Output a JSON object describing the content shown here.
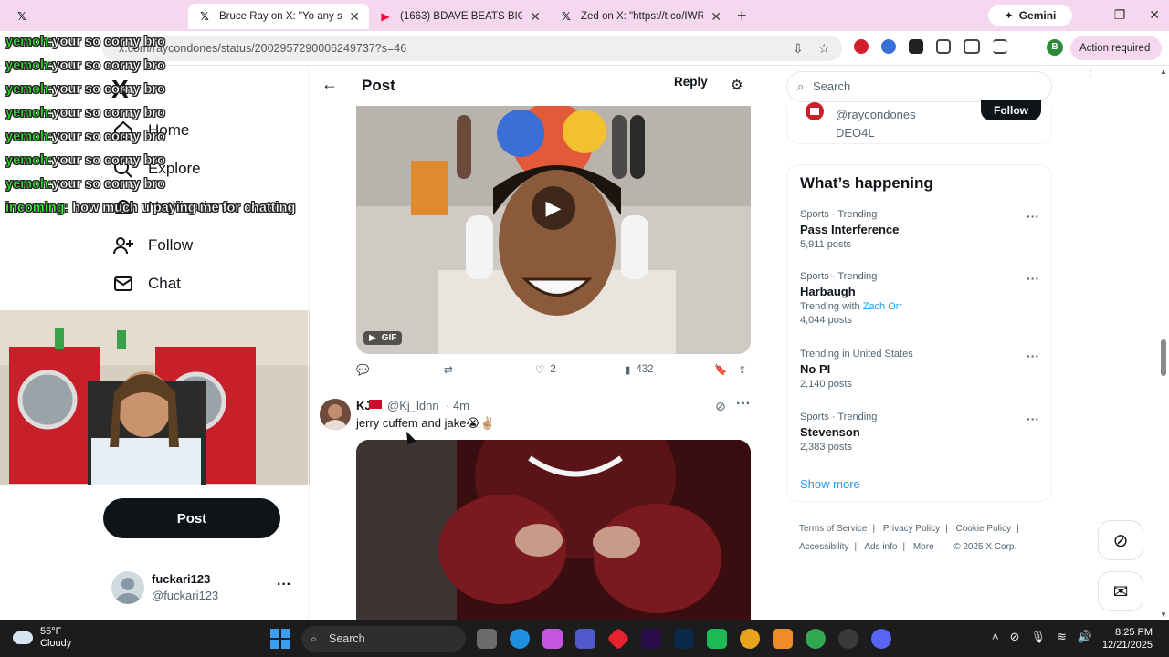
{
  "browser": {
    "tabs": [
      {
        "title": "",
        "active": false
      },
      {
        "title": "Bruce Ray on X: \"Yo any stream",
        "active": true
      },
      {
        "title": "(1663) BDAVE BEATS BIGLOAA",
        "active": false
      },
      {
        "title": "Zed on X: \"https://t.co/IWRJt6",
        "active": false
      }
    ],
    "gemini_label": "Gemini",
    "url": "x.com/raycondones/status/2002957290006249737?s=46",
    "action_required": "Action required",
    "profile_initial": "B"
  },
  "chat_overlay": {
    "lines": [
      {
        "user": "yemoh:",
        "message": "your so corny bro"
      },
      {
        "user": "yemoh:",
        "message": "your so corny bro"
      },
      {
        "user": "yemoh:",
        "message": "your so corny bro"
      },
      {
        "user": "yemoh:",
        "message": "your so corny bro"
      },
      {
        "user": "yemoh:",
        "message": "your so corny bro"
      },
      {
        "user": "yemoh:",
        "message": "your so corny bro"
      },
      {
        "user": "yemoh:",
        "message": "your so corny bro"
      },
      {
        "user": "incoming:",
        "message": "how much u paying me for chatting"
      }
    ]
  },
  "left_nav": {
    "logo": "X",
    "items": [
      {
        "label": "Home",
        "icon": "home-icon"
      },
      {
        "label": "Explore",
        "icon": "search-icon"
      },
      {
        "label": "Notifications",
        "icon": "bell-icon"
      },
      {
        "label": "Follow",
        "icon": "person-add-icon"
      },
      {
        "label": "Chat",
        "icon": "mail-icon"
      }
    ],
    "post_button": "Post",
    "account": {
      "name": "fuckari123",
      "handle": "@fuckari123"
    }
  },
  "main": {
    "header_title": "Post",
    "reply_label": "Reply",
    "gif_badge": "GIF",
    "tweet1_actions": {
      "likes": "2",
      "views": "432"
    },
    "tweet2": {
      "name": "KJ",
      "handle": "@Kj_ldnn",
      "time": "· 4m",
      "text": "jerry cuffem and jake😭✌🏼"
    }
  },
  "sidebar": {
    "search_placeholder": "Search",
    "who_to_follow": {
      "handle": "@raycondones",
      "name": "DEO4L",
      "button": "Follow"
    },
    "happening_title": "What’s happening",
    "trends": [
      {
        "context": "Sports · Trending",
        "topic": "Pass Interference",
        "with_label": "",
        "with_link": "",
        "count": "5,911 posts"
      },
      {
        "context": "Sports · Trending",
        "topic": "Harbaugh",
        "with_label": "Trending with",
        "with_link": "Zach Orr",
        "count": "4,044 posts"
      },
      {
        "context": "Trending in United States",
        "topic": "No PI",
        "with_label": "",
        "with_link": "",
        "count": "2,140 posts"
      },
      {
        "context": "Sports · Trending",
        "topic": "Stevenson",
        "with_label": "",
        "with_link": "",
        "count": "2,383 posts"
      }
    ],
    "show_more": "Show more",
    "footer": {
      "terms": "Terms of Service",
      "privacy": "Privacy Policy",
      "cookie": "Cookie Policy",
      "accessibility": "Accessibility",
      "ads": "Ads info",
      "more": "More ···",
      "copyright": "© 2025 X Corp."
    }
  },
  "taskbar": {
    "weather_temp": "55°F",
    "weather_desc": "Cloudy",
    "search_label": "Search",
    "time": "8:25 PM",
    "date": "12/21/2025"
  },
  "colors": {
    "tabbar_bg": "#f6d7f0",
    "x_blue": "#1d9bf0",
    "chat_user_green": "#2ce02c",
    "taskbar_bg": "#1c1c1c"
  }
}
